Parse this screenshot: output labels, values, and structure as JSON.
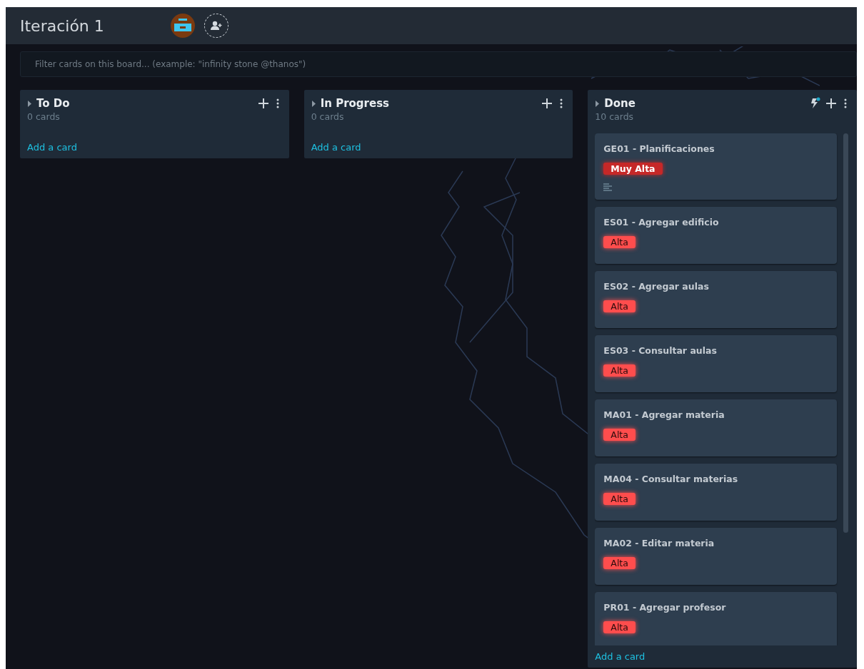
{
  "board": {
    "title": "Iteración 1"
  },
  "filter": {
    "placeholder": "Filter cards on this board... (example: \"infinity stone @thanos\")"
  },
  "lists": [
    {
      "title": "To Do",
      "count": "0 cards",
      "automation": false,
      "add_card": "Add a card"
    },
    {
      "title": "In Progress",
      "count": "0 cards",
      "automation": false,
      "add_card": "Add a card"
    },
    {
      "title": "Done",
      "count": "10 cards",
      "automation": true,
      "add_card": "Add a card",
      "cards": [
        {
          "title": "GE01 - Planificaciones",
          "label": "Muy Alta",
          "color": "#c62828",
          "has_description": true
        },
        {
          "title": "ES01 - Agregar edificio",
          "label": "Alta",
          "color": "#ff4d4d",
          "has_description": false
        },
        {
          "title": "ES02 - Agregar aulas",
          "label": "Alta",
          "color": "#ff4d4d",
          "has_description": false
        },
        {
          "title": "ES03 - Consultar aulas",
          "label": "Alta",
          "color": "#ff4d4d",
          "has_description": false
        },
        {
          "title": "MA01 - Agregar materia",
          "label": "Alta",
          "color": "#ff4d4d",
          "has_description": false
        },
        {
          "title": "MA04 - Consultar materias",
          "label": "Alta",
          "color": "#ff4d4d",
          "has_description": false
        },
        {
          "title": "MA02 - Editar materia",
          "label": "Alta",
          "color": "#ff4d4d",
          "has_description": false
        },
        {
          "title": "PR01 - Agregar profesor",
          "label": "Alta",
          "color": "#ff4d4d",
          "has_description": false
        }
      ]
    }
  ]
}
